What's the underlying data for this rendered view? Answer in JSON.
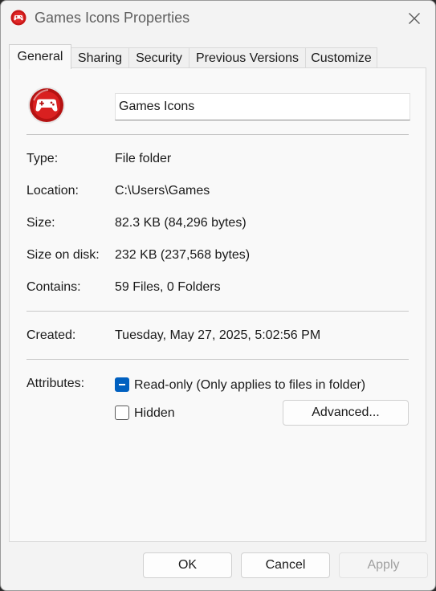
{
  "window": {
    "title": "Games Icons Properties",
    "accent": "#0060c0",
    "icon_name": "game-controller-icon",
    "icon_color": "#d01c1c"
  },
  "tabs": [
    {
      "label": "General",
      "active": true
    },
    {
      "label": "Sharing",
      "active": false
    },
    {
      "label": "Security",
      "active": false
    },
    {
      "label": "Previous Versions",
      "active": false
    },
    {
      "label": "Customize",
      "active": false
    }
  ],
  "general": {
    "folder_name": "Games Icons",
    "type_label": "Type:",
    "type_value": "File folder",
    "location_label": "Location:",
    "location_value": "C:\\Users\\Games",
    "size_label": "Size:",
    "size_value": "82.3 KB (84,296 bytes)",
    "size_on_disk_label": "Size on disk:",
    "size_on_disk_value": "232 KB (237,568 bytes)",
    "contains_label": "Contains:",
    "contains_value": "59 Files, 0 Folders",
    "created_label": "Created:",
    "created_value": "Tuesday, May 27, 2025, 5:02:56 PM",
    "attributes_label": "Attributes:",
    "readonly_label": "Read-only (Only applies to files in folder)",
    "readonly_state": "indeterminate",
    "hidden_label": "Hidden",
    "hidden_state": "unchecked",
    "advanced_label": "Advanced..."
  },
  "footer": {
    "ok_label": "OK",
    "cancel_label": "Cancel",
    "apply_label": "Apply",
    "apply_enabled": false
  }
}
